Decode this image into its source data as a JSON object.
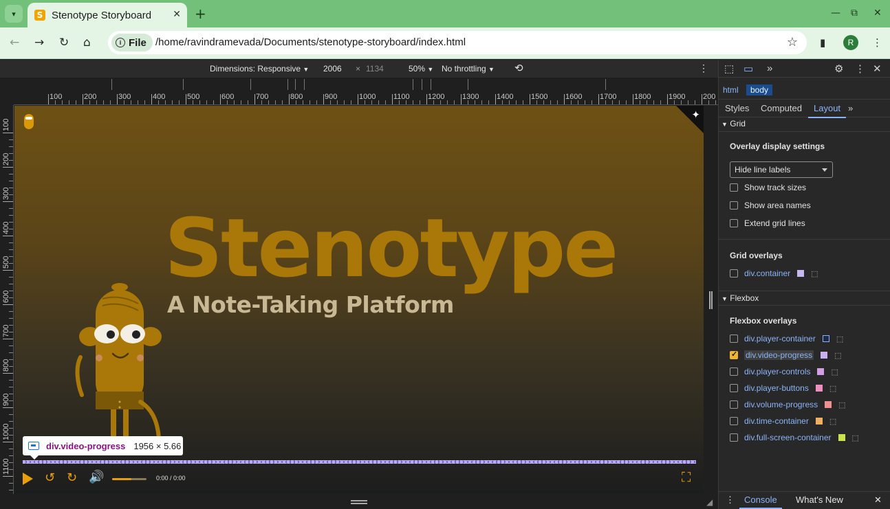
{
  "tab": {
    "favicon": "S",
    "title": "Stenotype Storyboard",
    "close": "✕"
  },
  "toolbar": {
    "origin_label": "File",
    "url": "/home/ravindramevada/Documents/stenotype-storyboard/index.html",
    "profile_initial": "R"
  },
  "device_bar": {
    "dimensions_label": "Dimensions: Responsive",
    "width": "2006",
    "times": "×",
    "height": "1134",
    "zoom": "50%",
    "throttle": "No throttling"
  },
  "rulers": {
    "horizontal": [
      "100",
      "200",
      "300",
      "400",
      "500",
      "600",
      "700",
      "800",
      "900",
      "1000",
      "1100",
      "1200",
      "1300",
      "1400",
      "1500",
      "1600",
      "1700",
      "1800",
      "1900",
      "200"
    ],
    "vertical": [
      "100",
      "200",
      "300",
      "400",
      "500",
      "600",
      "700",
      "800",
      "900",
      "1000",
      "1100"
    ]
  },
  "page": {
    "hero_title": "Stenotype",
    "hero_subtitle": "A Note-Taking Platform",
    "time": "0:00 / 0:00"
  },
  "inspect_tooltip": {
    "name": "div.video-progress",
    "size": "1956 × 5.66"
  },
  "devtools": {
    "breadcrumbs": [
      "html",
      "body"
    ],
    "tabs": [
      "Styles",
      "Computed",
      "Layout"
    ],
    "active_tab": "Layout",
    "grid_section": "Grid",
    "overlay_settings_title": "Overlay display settings",
    "line_labels_select": "Hide line labels",
    "grid_options": [
      "Show track sizes",
      "Show area names",
      "Extend grid lines"
    ],
    "grid_overlays_title": "Grid overlays",
    "grid_overlays": [
      {
        "name": "div.container",
        "color": "#c5b8f0"
      }
    ],
    "flexbox_section": "Flexbox",
    "flexbox_overlays_title": "Flexbox overlays",
    "flexbox_overlays": [
      {
        "name": "div.player-container",
        "color": "#1f2a44",
        "checked": false
      },
      {
        "name": "div.video-progress",
        "color": "#c9b0f0",
        "checked": true
      },
      {
        "name": "div.player-controls",
        "color": "#d59de6",
        "checked": false
      },
      {
        "name": "div.player-buttons",
        "color": "#ef8ec2",
        "checked": false
      },
      {
        "name": "div.volume-progress",
        "color": "#ef8f8f",
        "checked": false
      },
      {
        "name": "div.time-container",
        "color": "#f0b061",
        "checked": false
      },
      {
        "name": "div.full-screen-container",
        "color": "#c9e34a",
        "checked": false
      }
    ],
    "drawer_tabs": [
      "Console",
      "What's New"
    ]
  },
  "colors": {
    "accent": "#e9a008",
    "chrome_green": "#73c07a",
    "devtools_link": "#8ab4f8"
  }
}
